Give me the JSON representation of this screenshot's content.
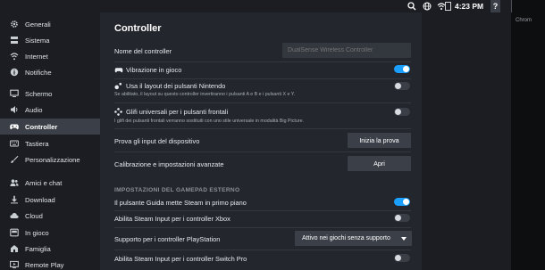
{
  "topbar": {
    "time": "4:23 PM",
    "help_label": "?",
    "icons": [
      "search-icon",
      "network-icon",
      "wifi-icon",
      "battery-icon"
    ]
  },
  "right_strip": {
    "label": "Chrom"
  },
  "sidebar": {
    "items": [
      {
        "label": "Generali",
        "icon": "gear-icon"
      },
      {
        "label": "Sistema",
        "icon": "system-icon"
      },
      {
        "label": "Internet",
        "icon": "wifi-icon"
      },
      {
        "label": "Notifiche",
        "icon": "info-icon"
      },
      {
        "label": "Schermo",
        "icon": "monitor-icon"
      },
      {
        "label": "Audio",
        "icon": "speaker-icon"
      },
      {
        "label": "Controller",
        "icon": "gamepad-icon",
        "active": true
      },
      {
        "label": "Tastiera",
        "icon": "keyboard-icon"
      },
      {
        "label": "Personalizzazione",
        "icon": "brush-icon"
      },
      {
        "label": "Amici e chat",
        "icon": "friends-icon"
      },
      {
        "label": "Download",
        "icon": "download-icon"
      },
      {
        "label": "Cloud",
        "icon": "cloud-icon"
      },
      {
        "label": "In gioco",
        "icon": "ingame-icon"
      },
      {
        "label": "Famiglia",
        "icon": "family-icon"
      },
      {
        "label": "Remote Play",
        "icon": "remoteplay-icon"
      }
    ]
  },
  "main": {
    "title": "Controller",
    "controller_name": {
      "label": "Nome del controller",
      "value": "",
      "placeholder": "DualSense Wireless Controller"
    },
    "vibration": {
      "label": "Vibrazione in gioco",
      "enabled": true
    },
    "nintendo_layout": {
      "label": "Usa il layout dei pulsanti Nintendo",
      "description": "Se abilitato, il layout su questo controller invertiranno i pulsanti A e B e i pulsanti X e Y.",
      "enabled": false
    },
    "universal_glyphs": {
      "label": "Glifi universali per i pulsanti frontali",
      "description": "I glifi dei pulsanti frontali verranno sostituiti con uno stile universale in modalità Big Picture.",
      "enabled": false
    },
    "test_input": {
      "label": "Prova gli input del dispositivo",
      "button": "Inizia la prova"
    },
    "calibration": {
      "label": "Calibrazione e impostazioni avanzate",
      "button": "Apri"
    },
    "section_external": "IMPOSTAZIONI DEL GAMEPAD ESTERNO",
    "guide_button": {
      "label": "Il pulsante Guida mette Steam in primo piano",
      "enabled": true
    },
    "xbox_input": {
      "label": "Abilita Steam Input per i controller Xbox",
      "enabled": false
    },
    "playstation_support": {
      "label": "Supporto per i controller PlayStation",
      "selected": "Attivo nei giochi senza supporto"
    },
    "switchpro_input": {
      "label": "Abilita Steam Input per i controller Switch Pro",
      "enabled": false
    }
  },
  "colors": {
    "accent": "#1a9fff",
    "background": "#23262c",
    "sidebar": "#1b1d22",
    "active_item": "#3b4048"
  }
}
